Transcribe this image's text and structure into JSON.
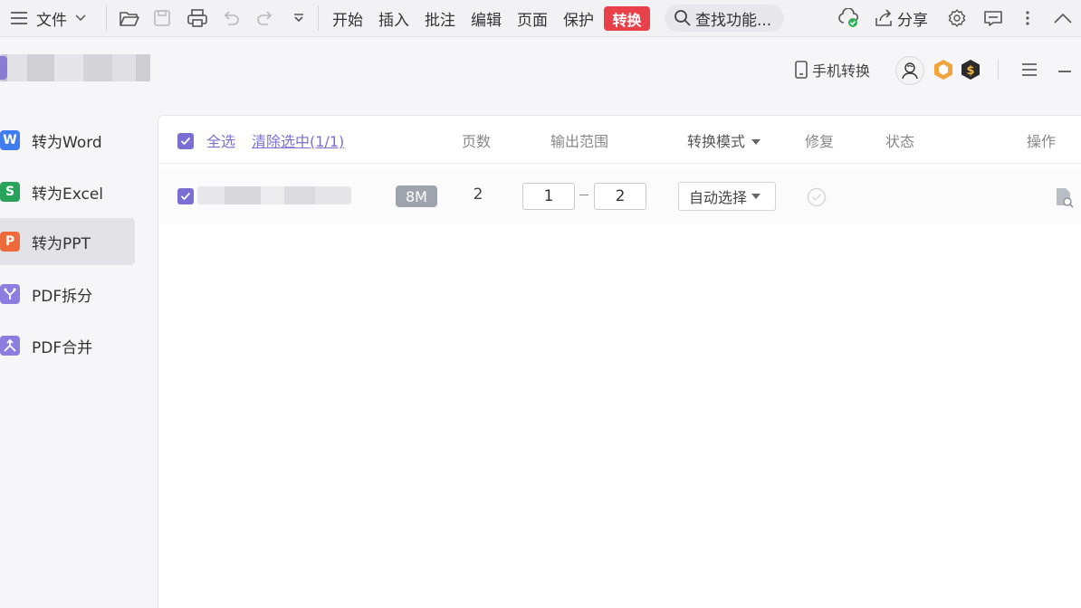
{
  "menubar": {
    "file_label": "文件",
    "tabs": [
      "开始",
      "插入",
      "批注",
      "编辑",
      "页面",
      "保护"
    ],
    "active_tab": "转换",
    "search_label": "查找功能...",
    "share_label": "分享"
  },
  "header": {
    "phone_convert_label": "手机转换"
  },
  "sidebar": {
    "items": [
      {
        "label": "转为Word",
        "icon_letter": "W",
        "color": "#3e7cf0"
      },
      {
        "label": "转为Excel",
        "icon_letter": "S",
        "color": "#27a35a"
      },
      {
        "label": "转为PPT",
        "icon_letter": "P",
        "color": "#ef6a3a"
      },
      {
        "label": "PDF拆分",
        "icon_letter": "",
        "color": "#8c7ee0"
      },
      {
        "label": "PDF合并",
        "icon_letter": "",
        "color": "#8c7ee0"
      }
    ],
    "active_index": 2
  },
  "table": {
    "select_all_label": "全选",
    "clear_selection_label": "清除选中(1/1)",
    "columns": {
      "pages": "页数",
      "range": "输出范围",
      "mode": "转换模式",
      "repair": "修复",
      "status": "状态",
      "actions": "操作"
    },
    "rows": [
      {
        "size": "8M",
        "pages": "2",
        "range_from": "1",
        "range_to": "2",
        "mode": "自动选择"
      }
    ]
  },
  "colors": {
    "accent": "#7b6fd6",
    "convert_tab": "#e8414a"
  }
}
